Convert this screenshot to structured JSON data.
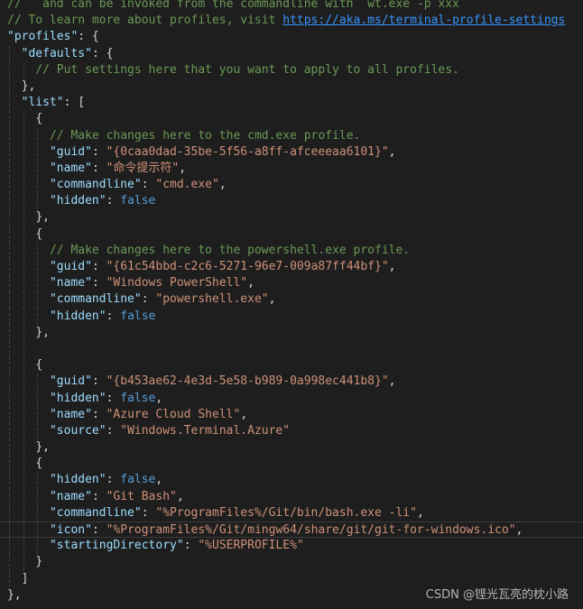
{
  "colors": {
    "background": "#1e1e1e",
    "comment": "#6a9955",
    "link": "#3794ff",
    "key": "#9cdcfe",
    "string": "#ce9178",
    "boolean": "#569cd6",
    "punctuation": "#d4d4d4"
  },
  "lines": [
    {
      "indent": 0,
      "tokens": [
        {
          "t": "comment",
          "v": "//   and can be invoked from the commandline with `wt.exe -p xxx`"
        }
      ]
    },
    {
      "indent": 0,
      "tokens": [
        {
          "t": "comment",
          "v": "// To learn more about profiles, visit "
        },
        {
          "t": "link",
          "v": "https://aka.ms/terminal-profile-settings"
        }
      ]
    },
    {
      "indent": 0,
      "tokens": [
        {
          "t": "key",
          "v": "\"profiles\""
        },
        {
          "t": "punct",
          "v": ": {"
        }
      ]
    },
    {
      "indent": 1,
      "tokens": [
        {
          "t": "key",
          "v": "\"defaults\""
        },
        {
          "t": "punct",
          "v": ": {"
        }
      ]
    },
    {
      "indent": 2,
      "tokens": [
        {
          "t": "comment",
          "v": "// Put settings here that you want to apply to all profiles."
        }
      ]
    },
    {
      "indent": 1,
      "tokens": [
        {
          "t": "punct",
          "v": "},"
        }
      ]
    },
    {
      "indent": 1,
      "tokens": [
        {
          "t": "key",
          "v": "\"list\""
        },
        {
          "t": "punct",
          "v": ": ["
        }
      ]
    },
    {
      "indent": 2,
      "tokens": [
        {
          "t": "punct",
          "v": "{"
        }
      ]
    },
    {
      "indent": 3,
      "tokens": [
        {
          "t": "comment",
          "v": "// Make changes here to the cmd.exe profile."
        }
      ]
    },
    {
      "indent": 3,
      "tokens": [
        {
          "t": "key",
          "v": "\"guid\""
        },
        {
          "t": "punct",
          "v": ": "
        },
        {
          "t": "str",
          "v": "\"{0caa0dad-35be-5f56-a8ff-afceeeaa6101}\""
        },
        {
          "t": "punct",
          "v": ","
        }
      ]
    },
    {
      "indent": 3,
      "tokens": [
        {
          "t": "key",
          "v": "\"name\""
        },
        {
          "t": "punct",
          "v": ": "
        },
        {
          "t": "str",
          "v": "\"命令提示符\""
        },
        {
          "t": "punct",
          "v": ","
        }
      ]
    },
    {
      "indent": 3,
      "tokens": [
        {
          "t": "key",
          "v": "\"commandline\""
        },
        {
          "t": "punct",
          "v": ": "
        },
        {
          "t": "str",
          "v": "\"cmd.exe\""
        },
        {
          "t": "punct",
          "v": ","
        }
      ]
    },
    {
      "indent": 3,
      "tokens": [
        {
          "t": "key",
          "v": "\"hidden\""
        },
        {
          "t": "punct",
          "v": ": "
        },
        {
          "t": "bool",
          "v": "false"
        }
      ]
    },
    {
      "indent": 2,
      "tokens": [
        {
          "t": "punct",
          "v": "},"
        }
      ]
    },
    {
      "indent": 2,
      "tokens": [
        {
          "t": "punct",
          "v": "{"
        }
      ]
    },
    {
      "indent": 3,
      "tokens": [
        {
          "t": "comment",
          "v": "// Make changes here to the powershell.exe profile."
        }
      ]
    },
    {
      "indent": 3,
      "tokens": [
        {
          "t": "key",
          "v": "\"guid\""
        },
        {
          "t": "punct",
          "v": ": "
        },
        {
          "t": "str",
          "v": "\"{61c54bbd-c2c6-5271-96e7-009a87ff44bf}\""
        },
        {
          "t": "punct",
          "v": ","
        }
      ]
    },
    {
      "indent": 3,
      "tokens": [
        {
          "t": "key",
          "v": "\"name\""
        },
        {
          "t": "punct",
          "v": ": "
        },
        {
          "t": "str",
          "v": "\"Windows PowerShell\""
        },
        {
          "t": "punct",
          "v": ","
        }
      ]
    },
    {
      "indent": 3,
      "tokens": [
        {
          "t": "key",
          "v": "\"commandline\""
        },
        {
          "t": "punct",
          "v": ": "
        },
        {
          "t": "str",
          "v": "\"powershell.exe\""
        },
        {
          "t": "punct",
          "v": ","
        }
      ]
    },
    {
      "indent": 3,
      "tokens": [
        {
          "t": "key",
          "v": "\"hidden\""
        },
        {
          "t": "punct",
          "v": ": "
        },
        {
          "t": "bool",
          "v": "false"
        }
      ]
    },
    {
      "indent": 2,
      "tokens": [
        {
          "t": "punct",
          "v": "},"
        }
      ]
    },
    {
      "indent": 2,
      "tokens": []
    },
    {
      "indent": 2,
      "tokens": [
        {
          "t": "punct",
          "v": "{"
        }
      ]
    },
    {
      "indent": 3,
      "tokens": [
        {
          "t": "key",
          "v": "\"guid\""
        },
        {
          "t": "punct",
          "v": ": "
        },
        {
          "t": "str",
          "v": "\"{b453ae62-4e3d-5e58-b989-0a998ec441b8}\""
        },
        {
          "t": "punct",
          "v": ","
        }
      ]
    },
    {
      "indent": 3,
      "tokens": [
        {
          "t": "key",
          "v": "\"hidden\""
        },
        {
          "t": "punct",
          "v": ": "
        },
        {
          "t": "bool",
          "v": "false"
        },
        {
          "t": "punct",
          "v": ","
        }
      ]
    },
    {
      "indent": 3,
      "tokens": [
        {
          "t": "key",
          "v": "\"name\""
        },
        {
          "t": "punct",
          "v": ": "
        },
        {
          "t": "str",
          "v": "\"Azure Cloud Shell\""
        },
        {
          "t": "punct",
          "v": ","
        }
      ]
    },
    {
      "indent": 3,
      "tokens": [
        {
          "t": "key",
          "v": "\"source\""
        },
        {
          "t": "punct",
          "v": ": "
        },
        {
          "t": "str",
          "v": "\"Windows.Terminal.Azure\""
        }
      ]
    },
    {
      "indent": 2,
      "tokens": [
        {
          "t": "punct",
          "v": "},"
        }
      ]
    },
    {
      "indent": 2,
      "tokens": [
        {
          "t": "punct",
          "v": "{"
        }
      ]
    },
    {
      "indent": 3,
      "tokens": [
        {
          "t": "key",
          "v": "\"hidden\""
        },
        {
          "t": "punct",
          "v": ": "
        },
        {
          "t": "bool",
          "v": "false"
        },
        {
          "t": "punct",
          "v": ","
        }
      ]
    },
    {
      "indent": 3,
      "tokens": [
        {
          "t": "key",
          "v": "\"name\""
        },
        {
          "t": "punct",
          "v": ": "
        },
        {
          "t": "str",
          "v": "\"Git Bash\""
        },
        {
          "t": "punct",
          "v": ","
        }
      ]
    },
    {
      "indent": 3,
      "tokens": [
        {
          "t": "key",
          "v": "\"commandline\""
        },
        {
          "t": "punct",
          "v": ": "
        },
        {
          "t": "str",
          "v": "\"%ProgramFiles%/Git/bin/bash.exe -li\""
        },
        {
          "t": "punct",
          "v": ","
        }
      ]
    },
    {
      "indent": 3,
      "highlight": true,
      "tokens": [
        {
          "t": "key",
          "v": "\"icon\""
        },
        {
          "t": "punct",
          "v": ": "
        },
        {
          "t": "str",
          "v": "\"%ProgramFiles%/Git/mingw64/share/git/git-for-windows.ico\""
        },
        {
          "t": "punct",
          "v": ","
        }
      ]
    },
    {
      "indent": 3,
      "tokens": [
        {
          "t": "key",
          "v": "\"startingDirectory\""
        },
        {
          "t": "punct",
          "v": ": "
        },
        {
          "t": "str",
          "v": "\"%USERPROFILE%\""
        }
      ]
    },
    {
      "indent": 2,
      "tokens": [
        {
          "t": "punct",
          "v": "}"
        }
      ]
    },
    {
      "indent": 1,
      "tokens": [
        {
          "t": "punct",
          "v": "]"
        }
      ]
    },
    {
      "indent": 0,
      "tokens": [
        {
          "t": "punct",
          "v": "},"
        }
      ]
    }
  ],
  "watermark": "CSDN @铿光瓦亮的枕小路"
}
